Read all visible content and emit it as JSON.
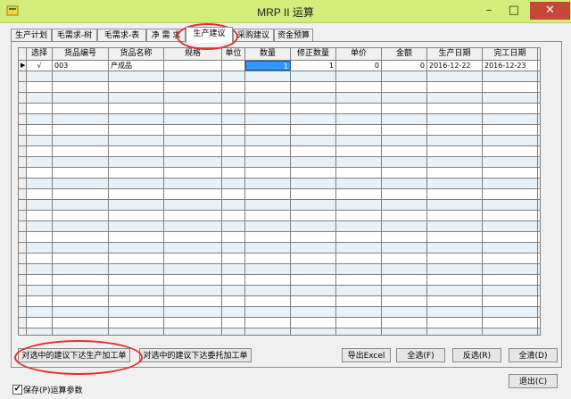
{
  "window": {
    "title": "MRP II 运算"
  },
  "tabs": [
    "生产计划",
    "毛需求-树",
    "毛需求-表",
    "净 需 求",
    "生产建议",
    "采购建议",
    "资金预算"
  ],
  "active_tab": 4,
  "grid": {
    "columns": [
      "选择",
      "货品编号",
      "货品名称",
      "规格",
      "单位",
      "数量",
      "修正数量",
      "单价",
      "金额",
      "生产日期",
      "完工日期"
    ],
    "rows": [
      {
        "indicator": "▶",
        "select": "√",
        "code": "003",
        "name": "产成品",
        "spec": "",
        "unit": "",
        "qty": "1",
        "adj_qty": "1",
        "price": "0",
        "amount": "0",
        "prod_date": "2016-12-22",
        "finish_date": "2016-12-23"
      }
    ]
  },
  "buttons": {
    "issue_production": "对选中的建议下达生产加工单",
    "issue_outsource": "对选中的建议下达委托加工单",
    "export_excel": "导出Excel",
    "select_all": "全选(F)",
    "invert_select": "反选(R)",
    "clear_all": "全清(D)",
    "exit": "退出(C)"
  },
  "save_params": {
    "label": "保存(P)运算参数",
    "checked": true
  },
  "colors": {
    "titlebar": "#d3ec7a",
    "annotation": "#e03030",
    "selected_cell": "#3399ff"
  }
}
